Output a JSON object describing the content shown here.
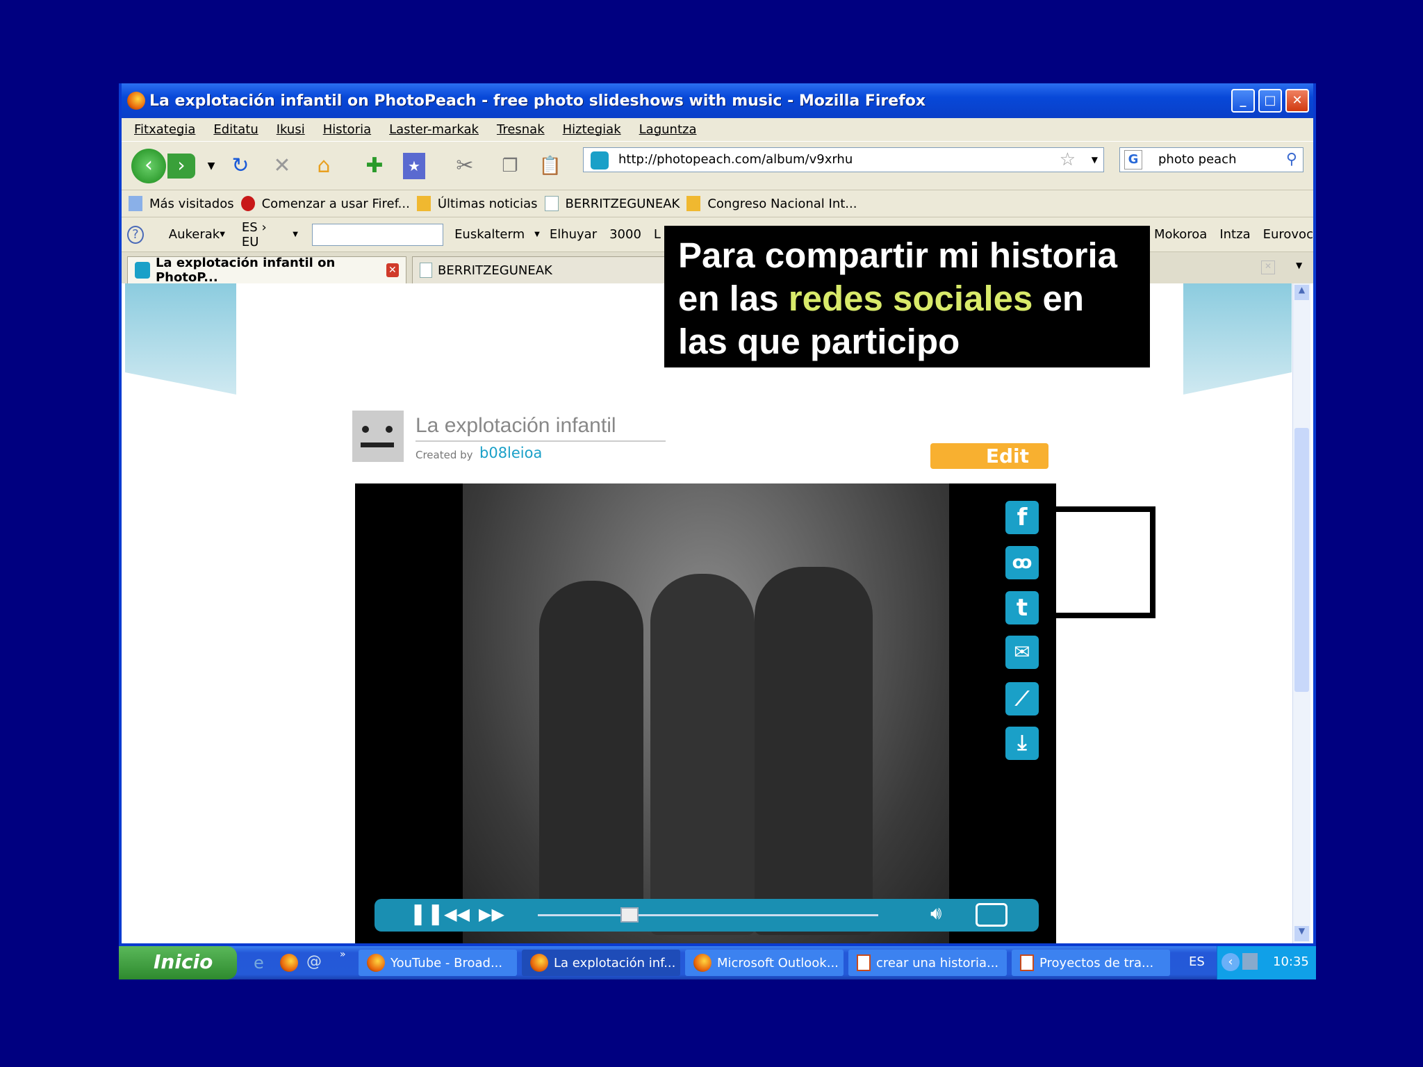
{
  "window": {
    "title": "La explotación infantil on PhotoPeach - free photo slideshows with music - Mozilla Firefox"
  },
  "menu": [
    "Fitxategia",
    "Editatu",
    "Ikusi",
    "Historia",
    "Laster-markak",
    "Tresnak",
    "Hiztegiak",
    "Laguntza"
  ],
  "toolbar": {
    "url": "http://photopeach.com/album/v9xrhu",
    "search": "photo peach"
  },
  "bookmarks": [
    "Más visitados",
    "Comenzar a usar Firef...",
    "Últimas noticias",
    "BERRITZEGUNEAK",
    "Congreso Nacional Int..."
  ],
  "addon": {
    "options": "Aukerak",
    "lang": "ES › EU",
    "input": "",
    "links": [
      "Euskalterm",
      "Elhuyar",
      "3000",
      "L",
      "Mokoroa",
      "Intza",
      "Eurovoc"
    ]
  },
  "tabs": [
    "La explotación infantil on PhotoP...",
    "BERRITZEGUNEAK"
  ],
  "page": {
    "album_title": "La explotación infantil",
    "created_by": "Created by",
    "author": "b08leioa",
    "edit": "Edit",
    "player_progress": 0.27
  },
  "overlay": {
    "line1": "Para compartir mi historia",
    "line2a": "en las ",
    "line2b": "redes sociales",
    "line2c": " en",
    "line3": "las que participo"
  },
  "taskbar": {
    "start": "Inicio",
    "tasks": [
      "YouTube - Broad...",
      "La explotación inf...",
      "Microsoft Outlook...",
      "crear una historia...",
      "Proyectos de tra..."
    ],
    "lang": "ES",
    "clock": "10:35"
  }
}
